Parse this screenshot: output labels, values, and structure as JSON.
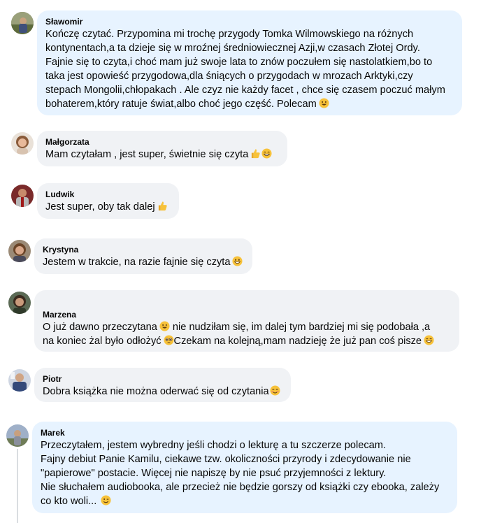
{
  "comments": [
    {
      "author": "Sławomir",
      "lines": [
        "Kończę czytać. Przypomina mi trochę przygody Tomka Wilmowskiego na różnych",
        "kontynentach,a ta dzieje się w mroźnej średniowiecznej Azji,w czasach Złotej Ordy.",
        "Fajnie się to czyta,i choć mam już swoje lata to znów poczułem się nastolatkiem,bo to",
        "taka jest opowieść przygodowa,dla śniących o przygodach w mrozach Arktyki,czy",
        "stepach Mongolii,chłopakach . Ale czyz nie każdy facet , chce się czasem poczuć małym",
        "bohaterem,który ratuje świat,albo choć jego część. Polecam"
      ]
    },
    {
      "author": "Małgorzata",
      "lines": [
        "Mam czytałam , jest super, świetnie się czyta"
      ]
    },
    {
      "author": "Ludwik",
      "lines": [
        "Jest super, oby tak dalej"
      ]
    },
    {
      "author": "Krystyna",
      "lines": [
        "Jestem w trakcie, na razie fajnie się czyta"
      ]
    },
    {
      "author": "Marzena",
      "lines": [
        "O już dawno przeczytana",
        " nie nudziłam się, im dalej tym bardziej mi się podobała ,a",
        "na koniec żal było odłożyć",
        "Czekam na kolejną,mam nadzieję że już pan coś pisze"
      ]
    },
    {
      "author": "Piotr",
      "lines": [
        "Dobra książka nie można oderwać się od czytania"
      ]
    },
    {
      "author": "Marek",
      "lines": [
        "Przeczytałem, jestem wybredny jeśli chodzi o lekturę a tu szczerze polecam.",
        "Fajny debiut Panie Kamilu, ciekawe tzw. okoliczności przyrody i zdecydowanie nie",
        "\"papierowe\" postacie. Więcej nie napiszę by nie psuć przyjemności z lektury.",
        "Nie słuchałem audiobooka, ale przecież nie będzie gorszy od książki czy ebooka, zależy",
        "co kto woli..."
      ]
    }
  ],
  "emoji": {
    "smile": "smiling-face-emoji",
    "thumbs": "thumbs-up-emoji",
    "grin": "grinning-face-emoji",
    "pleading": "pleading-face-emoji",
    "blush": "blushing-face-emoji",
    "wink": "winking-face-emoji"
  },
  "colors": {
    "highlight_bubble": "#e7f3ff",
    "bubble": "#f0f2f5",
    "text": "#050505",
    "emoji_yellow": "#f7c23a"
  }
}
